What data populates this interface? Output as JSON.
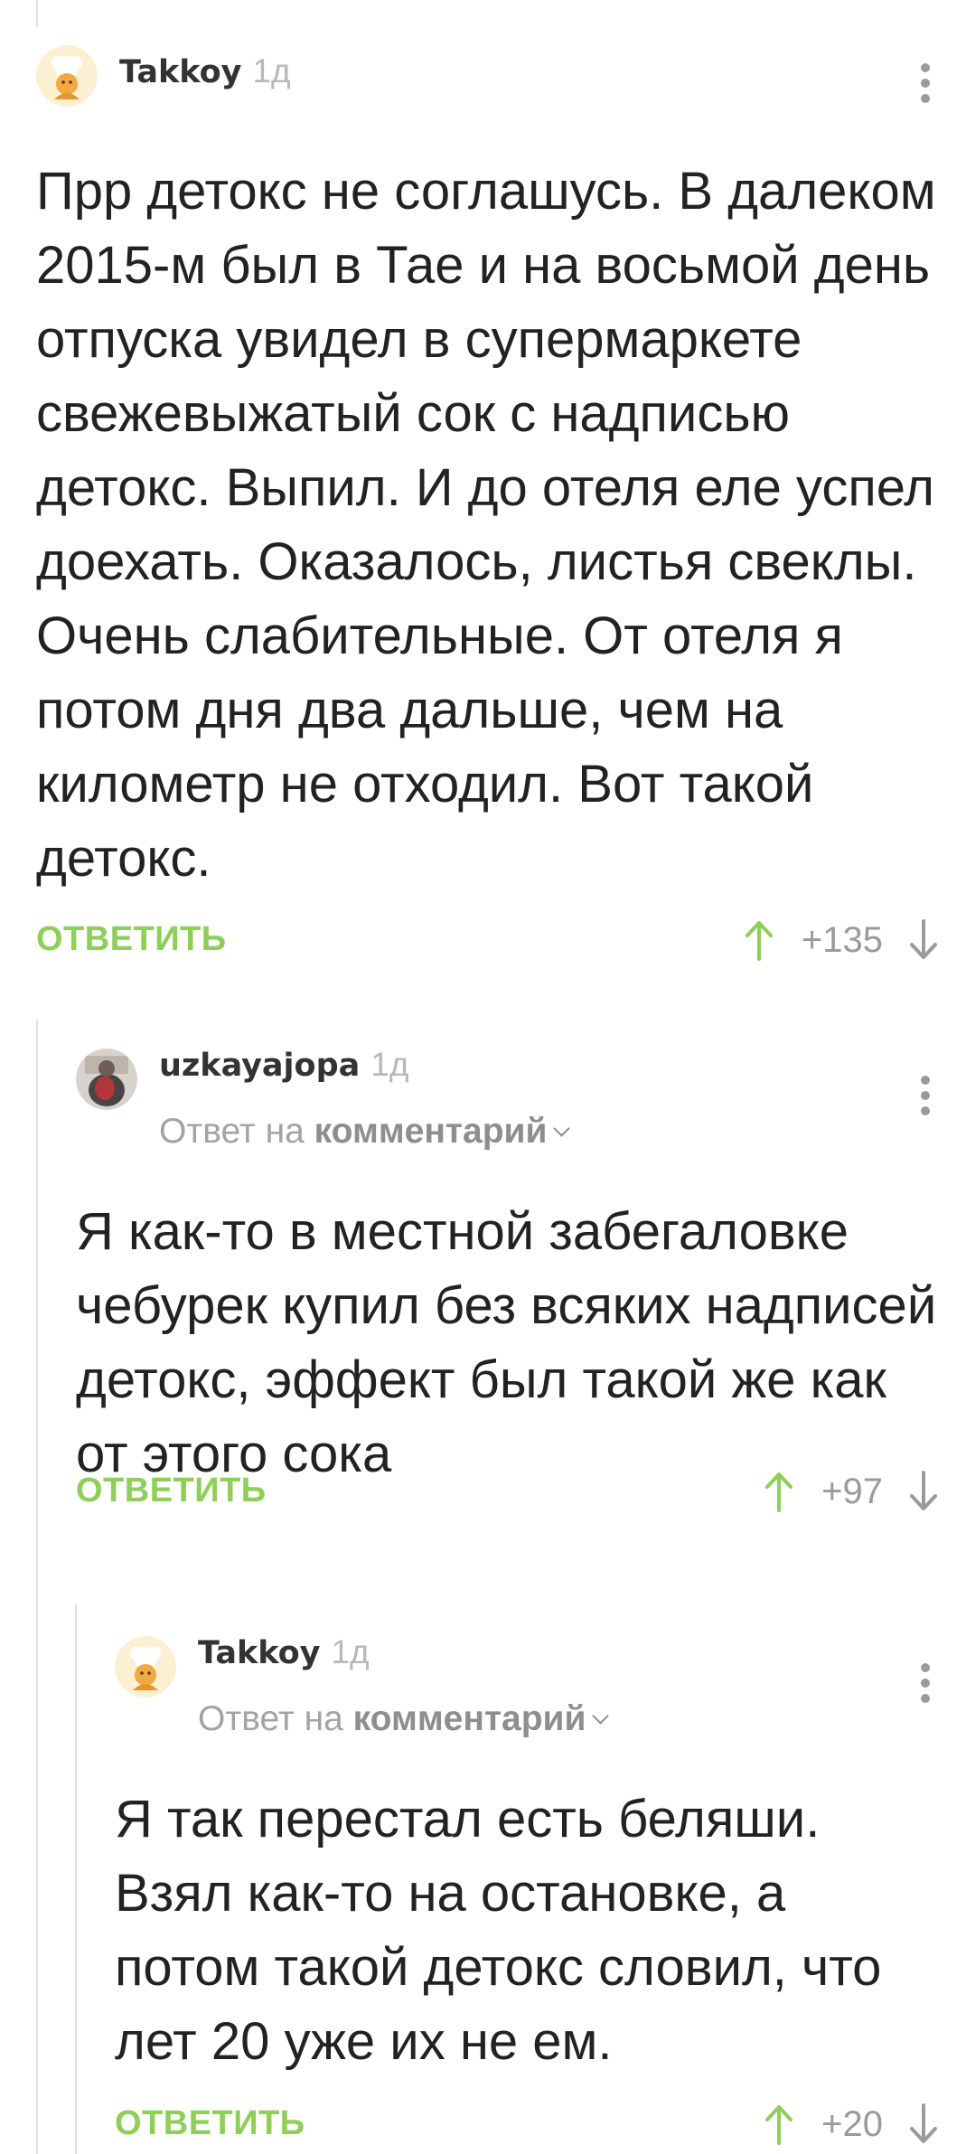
{
  "comments": [
    {
      "author": "Takkoy",
      "time": "1д",
      "text": "Прр детокс не соглашусь. В далеком 2015-м был в Тае и на восьмой день отпуска увидел в супермаркете свежевыжатый сок с надписью детокс. Выпил. И до отеля еле успел доехать. Оказалось, листья свеклы. Очень слабительные. От отеля я потом дня два дальше, чем на километр не отходил. Вот такой детокс.",
      "reply_label": "ОТВЕТИТЬ",
      "score": "+135"
    },
    {
      "author": "uzkayajopa",
      "time": "1д",
      "reply_prefix": "Ответ на",
      "reply_link": "комментарий",
      "text": "Я как-то в местной забегаловке чебурек купил без всяких надписей детокс, эффект был такой же как от этого сока",
      "reply_label": "ОТВЕТИТЬ",
      "score": "+97"
    },
    {
      "author": "Takkoy",
      "time": "1д",
      "reply_prefix": "Ответ на",
      "reply_link": "комментарий",
      "text": "Я так перестал есть беляши. Взял как-то на остановке, а потом такой детокс словил, что лет 20 уже их не ем.",
      "reply_label": "ОТВЕТИТЬ",
      "score": "+20"
    }
  ],
  "colors": {
    "accent_green": "#8fce58",
    "muted_gray": "#9a9a9a",
    "thread_line": "#e2e2e2"
  },
  "icons": [
    "avatar-cook-icon",
    "avatar-photo",
    "more-vertical-icon",
    "upvote-arrow-icon",
    "downvote-arrow-icon",
    "chevron-down-icon"
  ]
}
